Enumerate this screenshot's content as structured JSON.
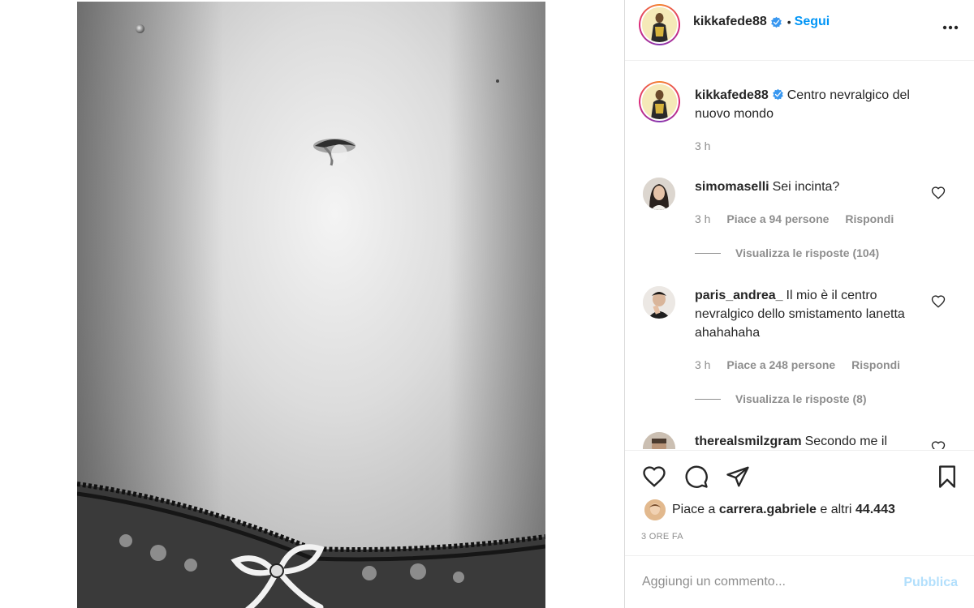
{
  "post": {
    "author": "kikkafede88",
    "follow_label": "Segui",
    "separator": "•",
    "caption": "Centro nevralgico del nuovo mondo",
    "caption_time": "3 h"
  },
  "comments": [
    {
      "user": "simomaselli",
      "text": "Sei incinta?",
      "time": "3 h",
      "likes": "Piace a 94 persone",
      "reply": "Rispondi",
      "view_replies": "Visualizza le risposte (104)"
    },
    {
      "user": "paris_andrea_",
      "text": "Il mio è il centro nevralgico dello smistamento lanetta ahahahaha",
      "time": "3 h",
      "likes": "Piace a 248 persone",
      "reply": "Rispondi",
      "view_replies": "Visualizza le risposte (8)"
    },
    {
      "user": "therealsmilzgram",
      "text": "Secondo me il"
    }
  ],
  "likes_summary": {
    "prefix": "Piace a",
    "user": "carrera.gabriele",
    "middle": "e altri",
    "count": "44.443"
  },
  "time_ago": "3 ORE FA",
  "add_comment": {
    "placeholder": "Aggiungi un commento...",
    "publish_label": "Pubblica"
  },
  "colors": {
    "accent": "#0095f6",
    "publish_disabled": "#b2dffc",
    "muted_text": "#8e8e8e"
  },
  "icons": [
    "verified-badge-icon",
    "more-options-icon",
    "heart-icon",
    "comment-icon",
    "share-icon",
    "bookmark-icon"
  ]
}
